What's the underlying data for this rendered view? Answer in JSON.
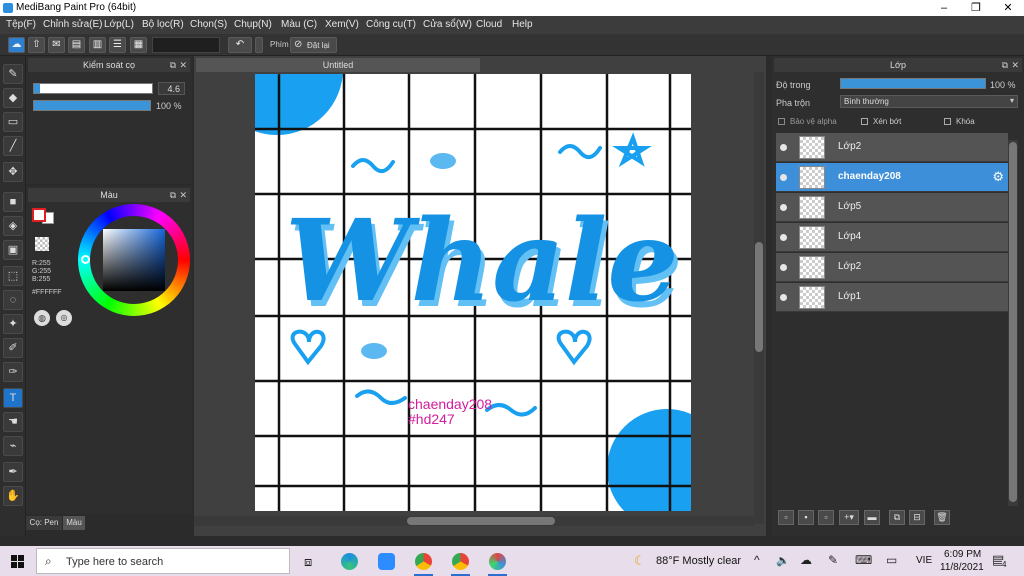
{
  "window": {
    "title": "MediBang Paint Pro (64bit)",
    "min": "–",
    "max": "❐",
    "close": "✕"
  },
  "menu": [
    "Tệp(F)",
    "Chỉnh sửa(E)",
    "Lớp(L)",
    "Bộ lọc(R)",
    "Chọn(S)",
    "Chụp(N)",
    "Màu (C)",
    "Xem(V)",
    "Công cụ(T)",
    "Cửa sổ(W)",
    "Cloud",
    "Help"
  ],
  "toolbar": {
    "shortcut_label": "Phím",
    "reset_label": "Đặt lại"
  },
  "brush_panel": {
    "title": "Kiểm soát cọ",
    "size_value": "4.6",
    "size_fill": 0.05,
    "opacity_value": "100 %",
    "opacity_fill": 1.0
  },
  "color_panel": {
    "title": "Màu",
    "r": "R:255",
    "g": "G:255",
    "b": "B:255",
    "hex": "#FFFFFF",
    "fg": "#e02020",
    "bg": "#ffffff"
  },
  "left_tabs": {
    "pen": "Cọ: Pen",
    "color": "Màu"
  },
  "canvas": {
    "tab_title": "Untitled",
    "artwork_word": "Whale",
    "signature_line1": "chaenday208",
    "signature_line2": "#hd247",
    "accent": "#1aa0f0",
    "signature_color": "#d21d9e"
  },
  "layers_panel": {
    "title": "Lớp",
    "opacity_label": "Độ trong",
    "opacity_value": "100 %",
    "opacity_fill": 1.0,
    "blend_label": "Pha trộn",
    "blend_value": "Bình thường",
    "protect_alpha": "Bảo vệ alpha",
    "clip": "Xén bớt",
    "lock": "Khóa",
    "layers": [
      {
        "name": "Lớp2",
        "active": false
      },
      {
        "name": "chaenday208",
        "active": true
      },
      {
        "name": "Lớp5",
        "active": false
      },
      {
        "name": "Lớp4",
        "active": false
      },
      {
        "name": "Lớp2",
        "active": false
      },
      {
        "name": "Lớp1",
        "active": false
      }
    ]
  },
  "taskbar": {
    "search_placeholder": "Type here to search",
    "weather": "88°F  Mostly clear",
    "lang": "VIE",
    "time": "6:09 PM",
    "date": "11/8/2021",
    "notif_count": "4"
  }
}
